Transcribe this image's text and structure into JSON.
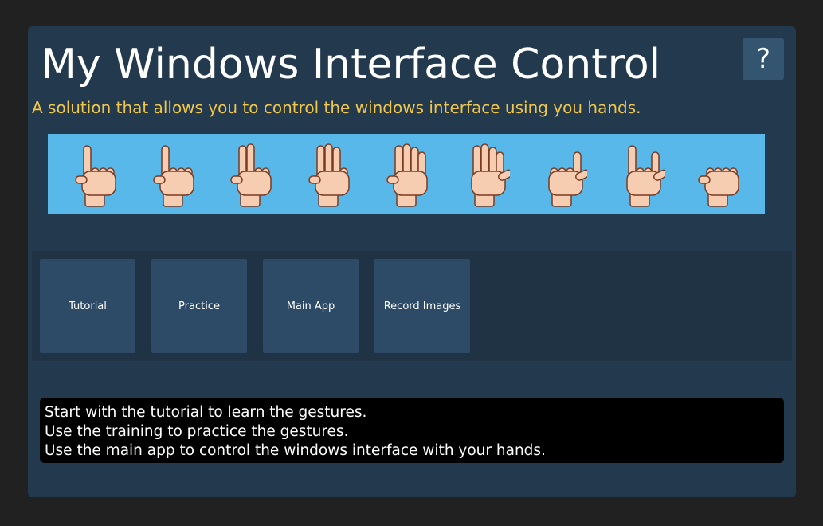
{
  "header": {
    "title": "My Windows Interface Control",
    "help_label": "?",
    "subtitle": "A solution that allows you to control the windows interface using you hands."
  },
  "banner": {
    "background": "#58b8ea",
    "gestures": [
      {
        "name": "one-finger",
        "fingers": [
          1,
          0,
          0,
          0,
          0
        ]
      },
      {
        "name": "index-up",
        "fingers": [
          1,
          0,
          0,
          0,
          0
        ]
      },
      {
        "name": "two-fingers",
        "fingers": [
          1,
          1,
          0,
          0,
          0
        ]
      },
      {
        "name": "three-fingers",
        "fingers": [
          1,
          1,
          1,
          0,
          0
        ]
      },
      {
        "name": "four-fingers",
        "fingers": [
          1,
          1,
          1,
          1,
          0
        ]
      },
      {
        "name": "five-fingers",
        "fingers": [
          1,
          1,
          1,
          1,
          1
        ]
      },
      {
        "name": "thumb-pinky",
        "fingers": [
          0,
          0,
          0,
          1,
          1
        ]
      },
      {
        "name": "rock",
        "fingers": [
          1,
          0,
          0,
          1,
          1
        ]
      },
      {
        "name": "fist",
        "fingers": [
          0,
          0,
          0,
          0,
          0
        ]
      }
    ]
  },
  "buttons": [
    {
      "label": "Tutorial"
    },
    {
      "label": "Practice"
    },
    {
      "label": "Main App"
    },
    {
      "label": "Record Images"
    }
  ],
  "console": {
    "lines": [
      "Start with the tutorial to learn the gestures.",
      "Use the training to practice the gestures.",
      "Use the main app to control the windows interface with your hands."
    ]
  },
  "colors": {
    "background": "#212121",
    "window": "#233a4e",
    "panel": "#1f3344",
    "button": "#2d4b66",
    "accent_text": "#f0c64c"
  }
}
